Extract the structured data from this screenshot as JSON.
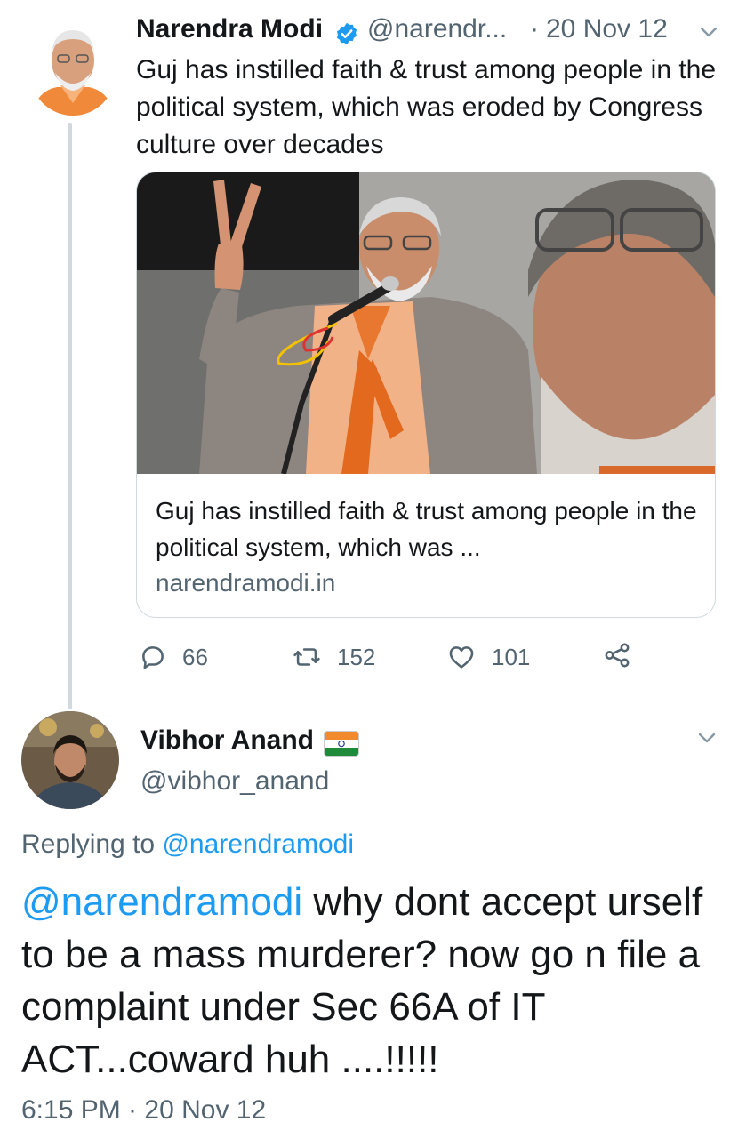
{
  "tweet1": {
    "name": "Narendra Modi",
    "handle": "@narendr...",
    "separator": "·",
    "date": "20 Nov 12",
    "text": "Guj has instilled faith & trust among people in the political system, which was eroded by Congress culture over decades",
    "card": {
      "title": "Guj has instilled faith & trust among people in the political system, which was ...",
      "domain": "narendramodi.in"
    },
    "actions": {
      "replies": "66",
      "retweets": "152",
      "likes": "101"
    }
  },
  "tweet2": {
    "name": "Vibhor Anand",
    "handle": "@vibhor_anand",
    "replying_prefix": "Replying to ",
    "replying_to": "@narendramodi",
    "mention": "@narendramodi",
    "text": " why dont accept urself to be a mass murderer? now go n file a complaint under Sec 66A of IT ACT...coward huh ....!!!!!",
    "timestamp": "6:15 PM · 20 Nov 12"
  },
  "colors": {
    "link_blue": "#1d9bf0",
    "secondary_text": "#536471",
    "thread_line": "#cfd9de"
  },
  "icons": [
    "verified-badge-icon",
    "chevron-down-icon",
    "reply-icon",
    "retweet-icon",
    "like-icon",
    "share-icon",
    "india-flag-icon"
  ]
}
